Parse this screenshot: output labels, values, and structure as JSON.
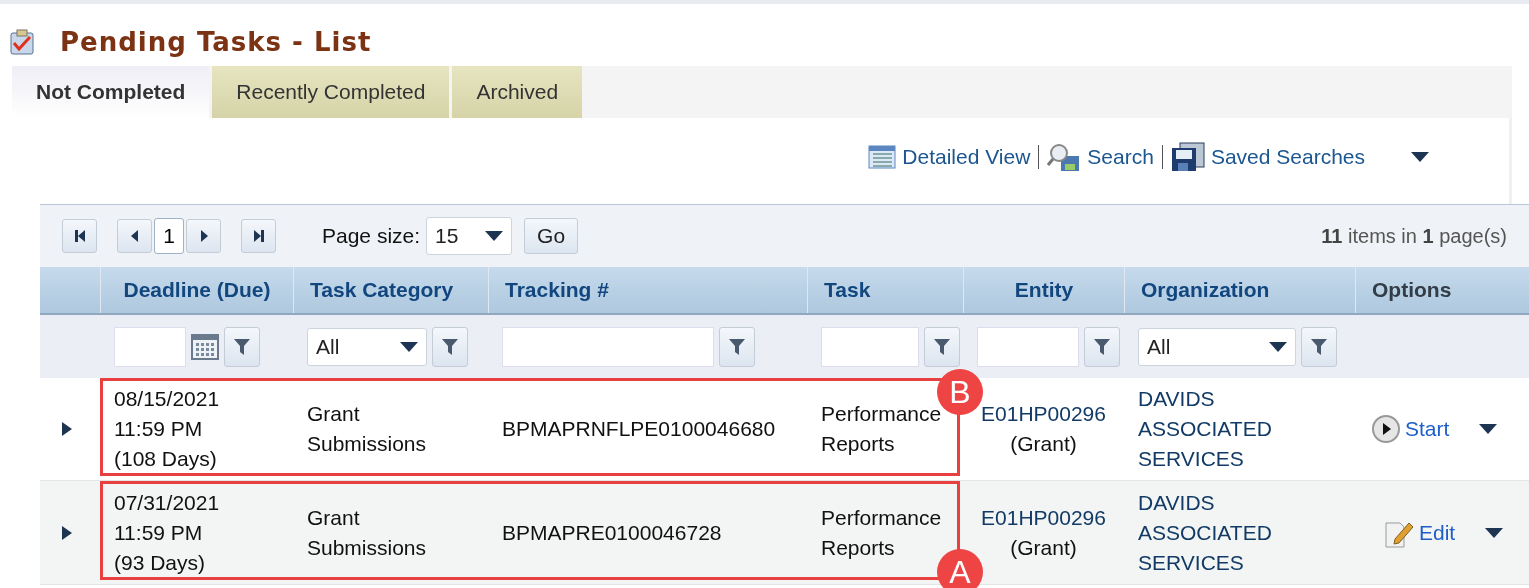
{
  "page": {
    "title": "Pending Tasks - List"
  },
  "tabs": [
    {
      "label": "Not Completed",
      "selected": true
    },
    {
      "label": "Recently Completed",
      "selected": false
    },
    {
      "label": "Archived",
      "selected": false
    }
  ],
  "toolbar": [
    {
      "kind": "list",
      "label": "Detailed View"
    },
    {
      "kind": "search",
      "label": "Search"
    },
    {
      "kind": "save",
      "label": "Saved Searches"
    }
  ],
  "pager": {
    "current_page": "1",
    "page_size_label": "Page size:",
    "page_size": "15",
    "go": "Go",
    "summary": "**11** items in **1** page(s)"
  },
  "table": {
    "columns": [
      {
        "label": "Deadline (Due)",
        "kind": "date"
      },
      {
        "label": "Task Category",
        "kind": "select",
        "value": "All"
      },
      {
        "label": "Tracking #",
        "kind": "text"
      },
      {
        "label": "Task",
        "kind": "text"
      },
      {
        "label": "Entity",
        "kind": "text"
      },
      {
        "label": "Organization",
        "kind": "select",
        "value": "All"
      },
      {
        "label": "Options",
        "kind": "none"
      }
    ],
    "rows": [
      {
        "deadline": "08/15/2021\n11:59 PM\n(108 Days)",
        "category": "Grant\nSubmissions",
        "tracking": "BPMAPRNFLPE0100046680",
        "task": "Performance\nReports",
        "entity": "E01HP00296",
        "entity_type": "(Grant)",
        "organization": "DAVIDS\nASSOCIATED\nSERVICES",
        "action": {
          "kind": "start",
          "label": "Start"
        },
        "annotation": {
          "label": "B",
          "kind": "upper"
        }
      },
      {
        "deadline": "07/31/2021\n11:59 PM\n(93 Days)",
        "category": "Grant\nSubmissions",
        "tracking": "BPMAPRE0100046728",
        "task": "Performance\nReports",
        "entity": "E01HP00296",
        "entity_type": "(Grant)",
        "organization": "DAVIDS\nASSOCIATED\nSERVICES",
        "action": {
          "kind": "edit",
          "label": "Edit"
        },
        "annotation": {
          "label": "A",
          "kind": "lower"
        }
      }
    ]
  }
}
